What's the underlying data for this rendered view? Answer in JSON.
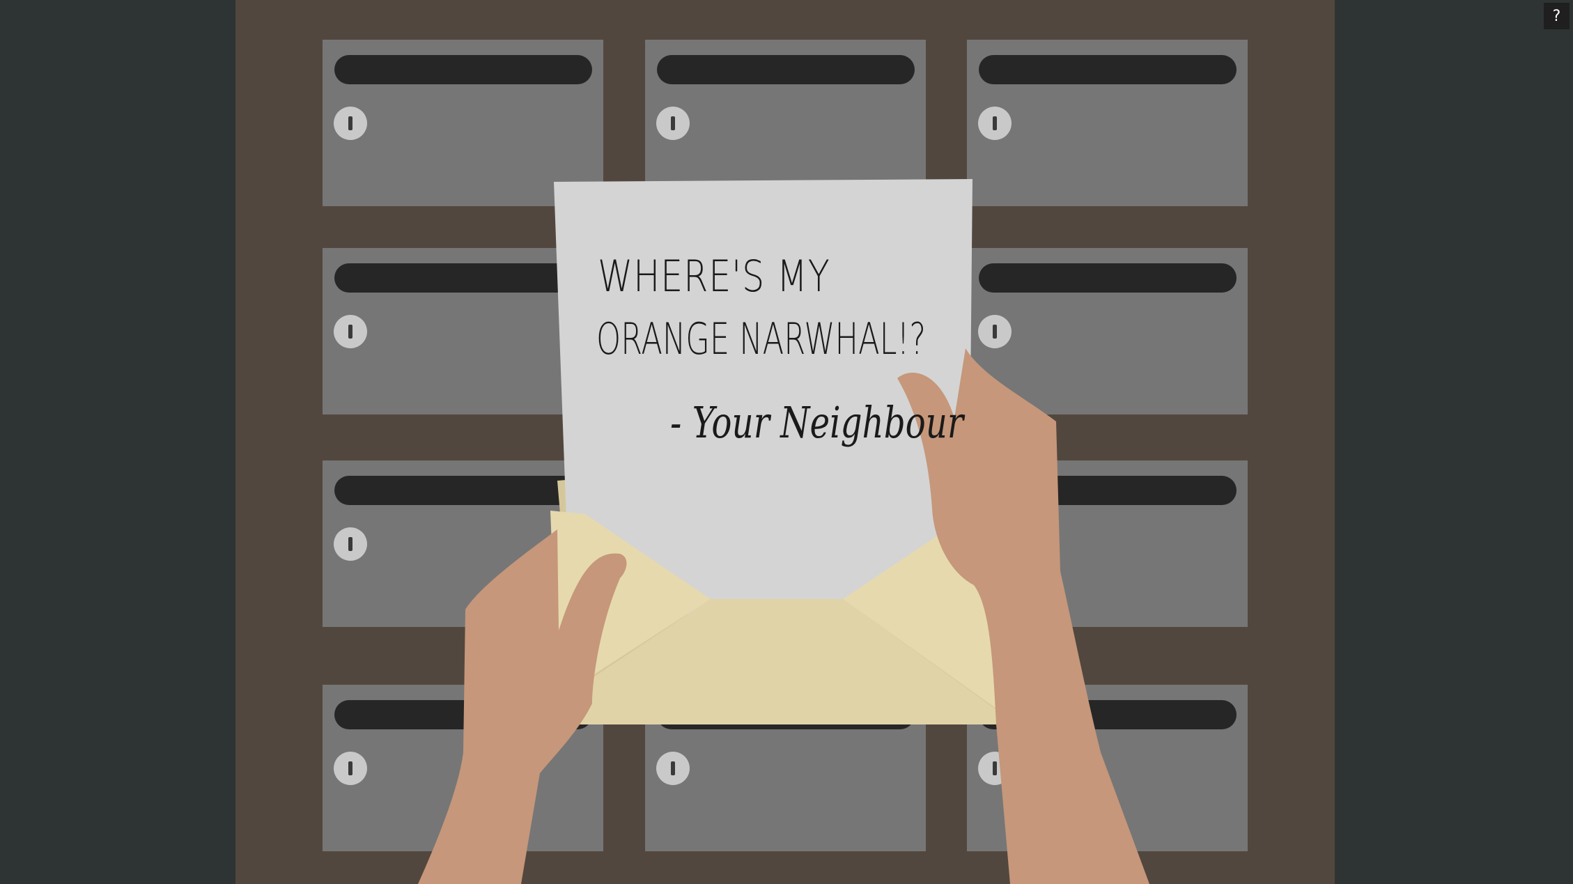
{
  "help_button": {
    "label": "?"
  },
  "letter": {
    "line1": "WHERE'S MY",
    "line2": "ORANGE NARWHAL!?",
    "line3": "- Your Neighbour"
  },
  "mailboxes": [
    {
      "id": "r1c1"
    },
    {
      "id": "r1c2"
    },
    {
      "id": "r1c3"
    },
    {
      "id": "r2c1"
    },
    {
      "id": "r2c2"
    },
    {
      "id": "r2c3"
    },
    {
      "id": "r3c1"
    },
    {
      "id": "r3c2"
    },
    {
      "id": "r3c3"
    },
    {
      "id": "r4c1"
    },
    {
      "id": "r4c2"
    },
    {
      "id": "r4c3"
    }
  ],
  "colors": {
    "background": "#2e3433",
    "wall": "#52473e",
    "mailbox": "#767676",
    "slot": "#262626",
    "paper": "#d4d4d4",
    "envelope": "#e5d8ae",
    "skin": "#c6977a"
  }
}
